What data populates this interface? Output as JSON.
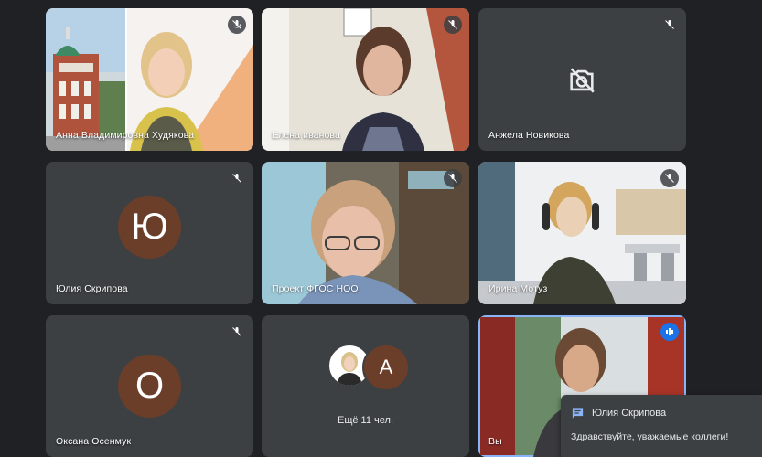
{
  "participants": {
    "p1": {
      "name": "Анна Владимировна Худякова"
    },
    "p2": {
      "name": "Елена иванова"
    },
    "p3": {
      "name": "Анжела Новикова"
    },
    "p4": {
      "name": "Юлия Скрипова",
      "initial": "Ю"
    },
    "p5": {
      "name": "Проект ФГОС НОО"
    },
    "p6": {
      "name": "Ирина Мотуз"
    },
    "p7": {
      "name": "Оксана Осенмук",
      "initial": "О"
    },
    "p8": {
      "more_label": "Ещё 11 чел.",
      "avatar_initial": "А"
    },
    "p9": {
      "name": "Вы"
    }
  },
  "chat_notification": {
    "sender": "Юлия Скрипова",
    "message": "Здравствуйте, уважаемые коллеги!"
  },
  "colors": {
    "background": "#202124",
    "tile": "#3c4043",
    "avatar_brown": "#6b3e2a",
    "active_border": "#8ab4f8",
    "speaking_blue": "#1a73e8"
  },
  "icons": [
    "mic-off-icon",
    "camera-off-icon",
    "speaking-indicator-icon",
    "chat-message-icon"
  ]
}
